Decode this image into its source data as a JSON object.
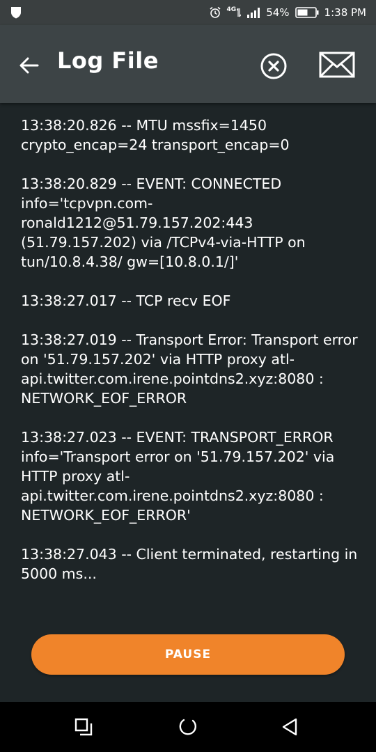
{
  "status_bar": {
    "network_type": "4G",
    "battery_percent": "54%",
    "time": "1:38 PM",
    "icons": [
      "shield-icon",
      "alarm-icon",
      "network-4g-icon",
      "signal-icon",
      "battery-icon"
    ]
  },
  "app_bar": {
    "title": "Log File",
    "back_icon": "arrow-left-icon",
    "clear_icon": "circle-x-icon",
    "mail_icon": "envelope-icon"
  },
  "log": {
    "entries": [
      "13:38:20.826 -- MTU mssfix=1450 crypto_encap=24 transport_encap=0",
      "13:38:20.829 -- EVENT: CONNECTED info='tcpvpn.com-ronald1212@51.79.157.202:443 (51.79.157.202) via /TCPv4-via-HTTP on tun/10.8.4.38/ gw=[10.8.0.1/]'",
      "13:38:27.017 -- TCP recv EOF",
      "13:38:27.019 -- Transport Error: Transport error on '51.79.157.202' via HTTP proxy atl-api.twitter.com.irene.pointdns2.xyz:8080 : NETWORK_EOF_ERROR",
      "13:38:27.023 -- EVENT: TRANSPORT_ERROR info='Transport error on '51.79.157.202' via HTTP proxy atl-api.twitter.com.irene.pointdns2.xyz:8080 : NETWORK_EOF_ERROR'",
      "13:38:27.043 -- Client terminated, restarting in 5000 ms..."
    ]
  },
  "controls": {
    "pause_label": "PAUSE",
    "accent_color": "#f0842a"
  },
  "nav_bar": {
    "icons": [
      "recents-icon",
      "home-icon",
      "back-triangle-icon"
    ]
  }
}
